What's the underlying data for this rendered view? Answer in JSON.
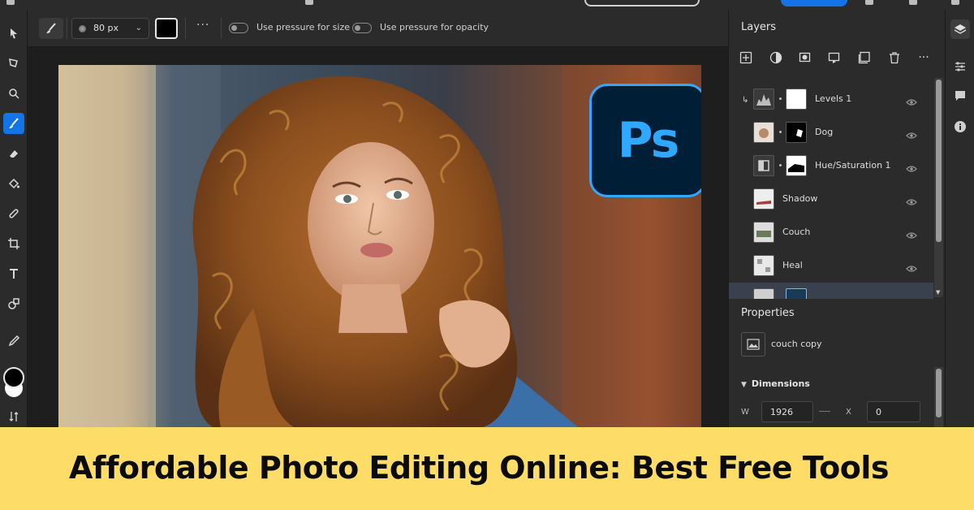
{
  "banner": {
    "title": "Affordable Photo Editing Online: Best Free Tools",
    "background": "#fddc68"
  },
  "options_bar": {
    "brush_size": "80 px",
    "more_label": "···",
    "pressure_size_label": "Use pressure for size",
    "pressure_opacity_label": "Use pressure for opacity",
    "pressure_size_on": false,
    "pressure_opacity_on": false,
    "color": "#000000"
  },
  "canvas": {
    "logo_text": "Ps",
    "logo_colors": {
      "bg": "#001e36",
      "fg": "#31a8ff"
    }
  },
  "layers_panel": {
    "title": "Layers",
    "toolbar_icons": [
      "add-layer-icon",
      "adjustment-icon",
      "mask-icon",
      "clip-icon",
      "group-icon",
      "delete-icon",
      "more-icon"
    ],
    "layers": [
      {
        "name": "Levels 1",
        "clipped": true,
        "visible": true
      },
      {
        "name": "Dog",
        "clipped": false,
        "visible": true
      },
      {
        "name": "Hue/Saturation 1",
        "clipped": false,
        "visible": true
      },
      {
        "name": "Shadow",
        "clipped": false,
        "visible": true
      },
      {
        "name": "Couch",
        "clipped": false,
        "visible": true
      },
      {
        "name": "Heal",
        "clipped": false,
        "visible": true
      },
      {
        "name": "",
        "clipped": false,
        "visible": true,
        "selected": true
      }
    ]
  },
  "properties_panel": {
    "title": "Properties",
    "selection_name": "couch copy",
    "dimensions_label": "Dimensions",
    "w_label": "W",
    "w_value": "1926",
    "x_label": "X",
    "x_value": "0"
  },
  "accent_color": "#1473e6"
}
